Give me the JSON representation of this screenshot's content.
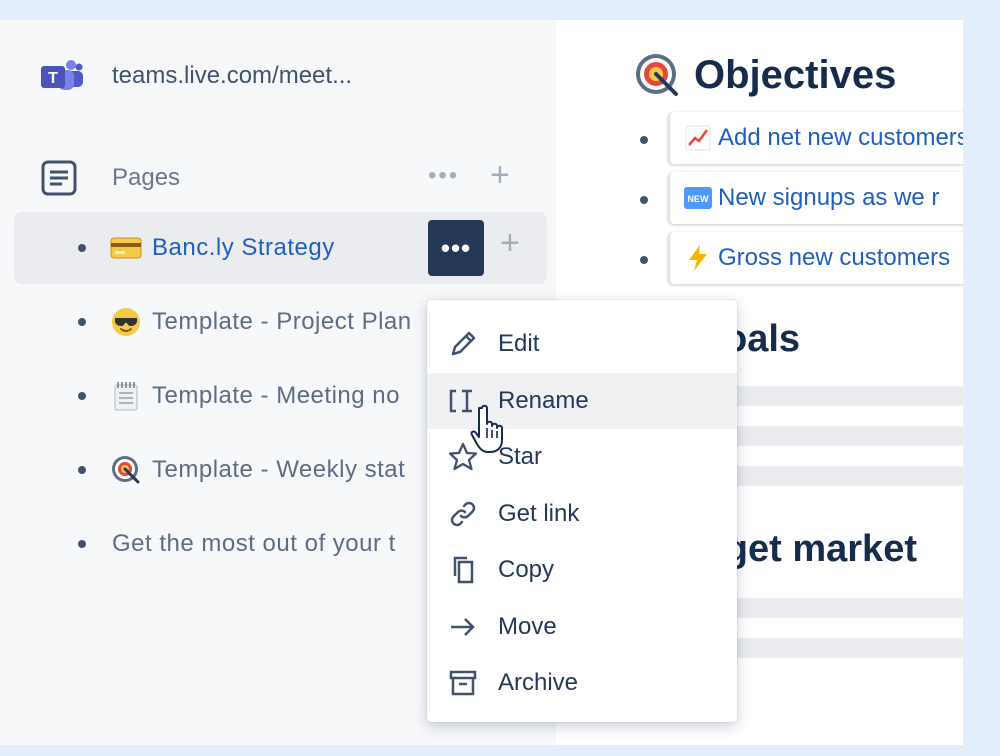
{
  "app": {
    "url": "teams.live.com/meet..."
  },
  "sidebar": {
    "section_label": "Pages",
    "more_label": "•••",
    "add_label": "+",
    "items": [
      {
        "label": "Banc.ly Strategy",
        "emoji": "credit-card-icon",
        "selected": true
      },
      {
        "label": "Template - Project Plan",
        "emoji": "sunglasses-face-icon"
      },
      {
        "label": "Template - Meeting no",
        "emoji": "spiral-notepad-icon"
      },
      {
        "label": "Template - Weekly stat",
        "emoji": "target-icon"
      },
      {
        "label": "Get the most out of your t",
        "emoji": ""
      }
    ]
  },
  "context_menu": {
    "items": [
      {
        "label": "Edit",
        "icon": "pencil-icon"
      },
      {
        "label": "Rename",
        "icon": "rename-cursor-icon",
        "hovered": true
      },
      {
        "label": "Star",
        "icon": "star-icon"
      },
      {
        "label": "Get link",
        "icon": "link-icon"
      },
      {
        "label": "Copy",
        "icon": "copy-icon"
      },
      {
        "label": "Move",
        "icon": "arrow-right-icon"
      },
      {
        "label": "Archive",
        "icon": "archive-icon"
      }
    ]
  },
  "main": {
    "objectives_title": "Objectives",
    "objectives": [
      {
        "emoji": "chart-increasing-icon",
        "text": "Add net new customers"
      },
      {
        "emoji": "new-button-icon",
        "text": "New signups as we r"
      },
      {
        "emoji": "lightning-icon",
        "text": "Gross new customers"
      }
    ],
    "goals_heading": "Goals",
    "goals_visible": "oals",
    "target_heading_visible": "rget market"
  },
  "colors": {
    "accent_link": "#1f5fbf",
    "selected_bg": "#ebecf0",
    "dots_button_bg": "#253858",
    "page_bg": "#e3eefc"
  }
}
